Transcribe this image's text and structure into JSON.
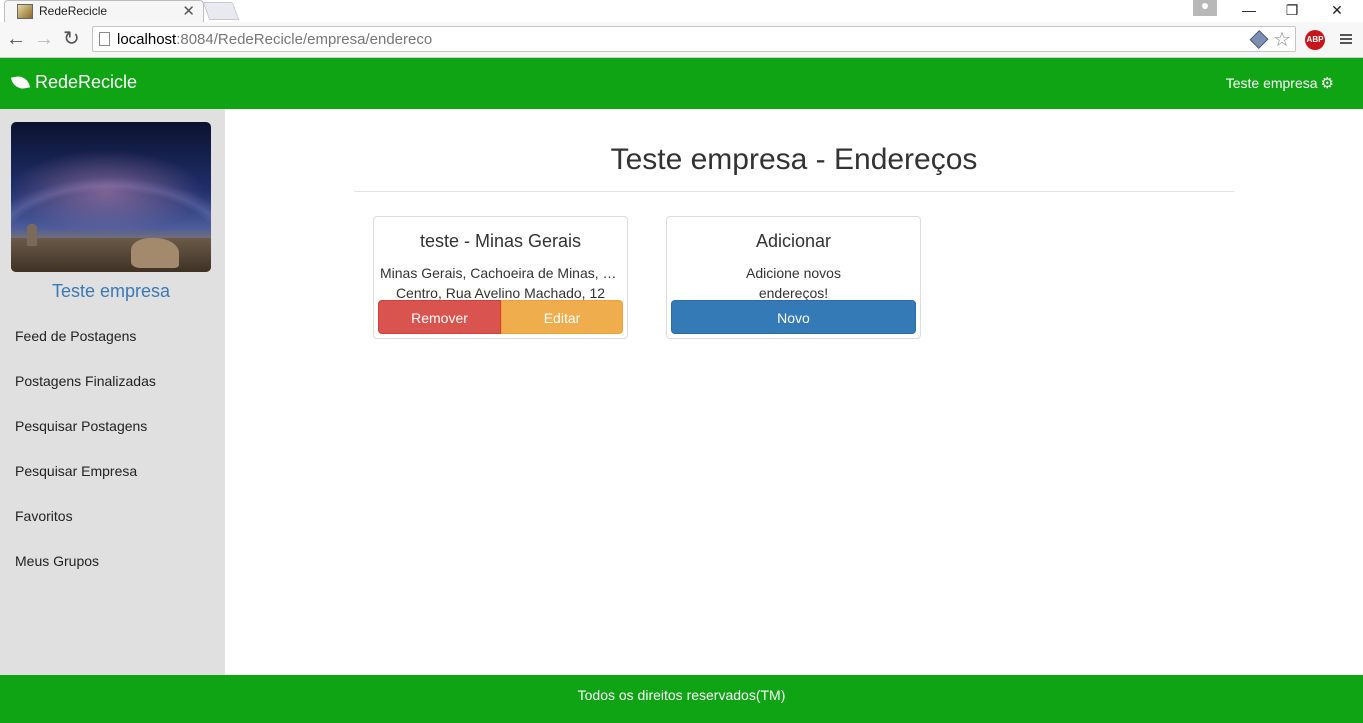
{
  "browser": {
    "tab_title": "RedeRecicle",
    "tab_close": "✕",
    "url_host": "localhost",
    "url_path": ":8084/RedeRecicle/empresa/endereco",
    "window_controls": [
      "—",
      "❐",
      "✕"
    ],
    "abp_label": "ABP"
  },
  "navbar": {
    "brand": "RedeRecicle",
    "user": "Teste empresa",
    "color": "#0ea413"
  },
  "sidebar": {
    "profile_name": "Teste empresa",
    "items": [
      {
        "label": "Feed de Postagens"
      },
      {
        "label": "Postagens Finalizadas"
      },
      {
        "label": "Pesquisar Postagens"
      },
      {
        "label": "Pesquisar Empresa"
      },
      {
        "label": "Favoritos"
      },
      {
        "label": "Meus Grupos"
      }
    ]
  },
  "main": {
    "title": "Teste empresa - Endereços",
    "address_card": {
      "title": "teste - Minas Gerais",
      "line1": "Minas Gerais, Cachoeira de Minas, Centro",
      "line2": "Centro, Rua Avelino Machado, 12",
      "remove_label": "Remover",
      "edit_label": "Editar"
    },
    "add_card": {
      "title": "Adicionar",
      "line1": "Adicione novos",
      "line2": "endereços!",
      "new_label": "Novo"
    }
  },
  "footer": {
    "text": "Todos os direitos reservados(TM)"
  }
}
